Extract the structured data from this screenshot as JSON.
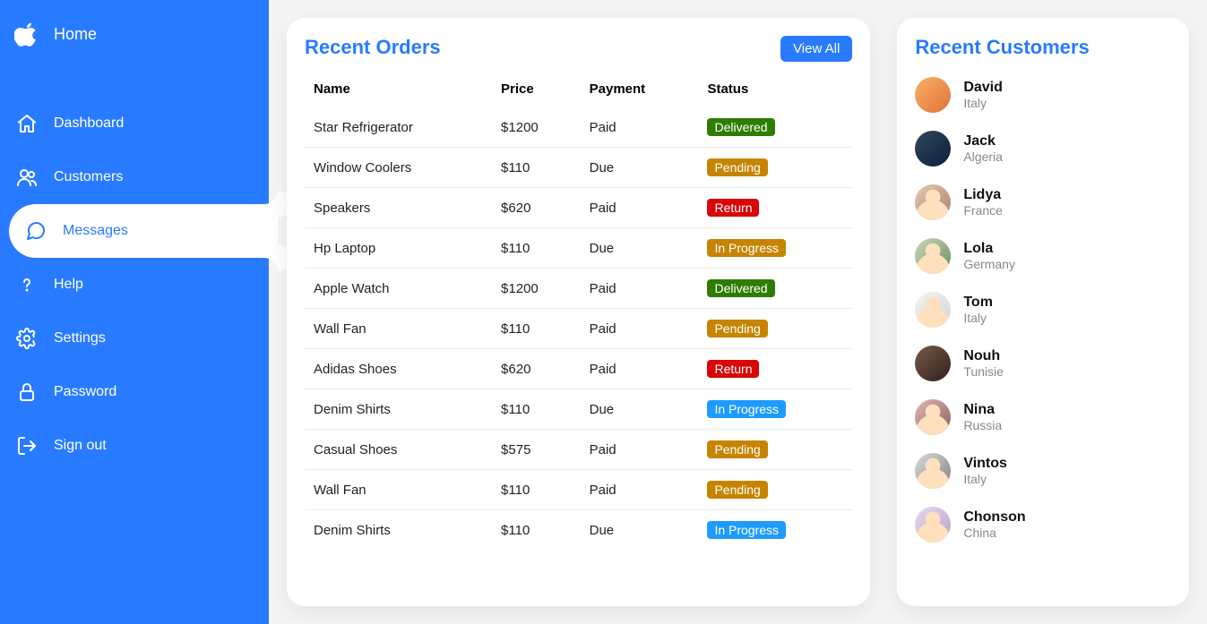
{
  "brand": {
    "label": "Home"
  },
  "nav": [
    {
      "label": "Dashboard",
      "icon": "home"
    },
    {
      "label": "Customers",
      "icon": "people"
    },
    {
      "label": "Messages",
      "icon": "chat",
      "active": true
    },
    {
      "label": "Help",
      "icon": "help"
    },
    {
      "label": "Settings",
      "icon": "gear"
    },
    {
      "label": "Password",
      "icon": "lock"
    },
    {
      "label": "Sign out",
      "icon": "signout"
    }
  ],
  "orders": {
    "title": "Recent Orders",
    "view_all": "View All",
    "columns": {
      "name": "Name",
      "price": "Price",
      "payment": "Payment",
      "status": "Status"
    },
    "rows": [
      {
        "name": "Star Refrigerator",
        "price": "$1200",
        "payment": "Paid",
        "status": "Delivered",
        "status_class": "delivered"
      },
      {
        "name": "Window Coolers",
        "price": "$110",
        "payment": "Due",
        "status": "Pending",
        "status_class": "pending"
      },
      {
        "name": "Speakers",
        "price": "$620",
        "payment": "Paid",
        "status": "Return",
        "status_class": "return"
      },
      {
        "name": "Hp Laptop",
        "price": "$110",
        "payment": "Due",
        "status": "In Progress",
        "status_class": "inprogress-1"
      },
      {
        "name": "Apple Watch",
        "price": "$1200",
        "payment": "Paid",
        "status": "Delivered",
        "status_class": "delivered"
      },
      {
        "name": "Wall Fan",
        "price": "$110",
        "payment": "Paid",
        "status": "Pending",
        "status_class": "pending"
      },
      {
        "name": "Adidas Shoes",
        "price": "$620",
        "payment": "Paid",
        "status": "Return",
        "status_class": "return"
      },
      {
        "name": "Denim Shirts",
        "price": "$110",
        "payment": "Due",
        "status": "In Progress",
        "status_class": "inprogress-2"
      },
      {
        "name": "Casual Shoes",
        "price": "$575",
        "payment": "Paid",
        "status": "Pending",
        "status_class": "pending"
      },
      {
        "name": "Wall Fan",
        "price": "$110",
        "payment": "Paid",
        "status": "Pending",
        "status_class": "pending"
      },
      {
        "name": "Denim Shirts",
        "price": "$110",
        "payment": "Due",
        "status": "In Progress",
        "status_class": "inprogress-2"
      }
    ]
  },
  "customers": {
    "title": "Recent Customers",
    "list": [
      {
        "name": "David",
        "country": "Italy",
        "avatar": "c1"
      },
      {
        "name": "Jack",
        "country": "Algeria",
        "avatar": "c2"
      },
      {
        "name": "Lidya",
        "country": "France",
        "avatar": "c3"
      },
      {
        "name": "Lola",
        "country": "Germany",
        "avatar": "c4"
      },
      {
        "name": "Tom",
        "country": "Italy",
        "avatar": "c5"
      },
      {
        "name": "Nouh",
        "country": "Tunisie",
        "avatar": "c6"
      },
      {
        "name": "Nina",
        "country": "Russia",
        "avatar": "c7"
      },
      {
        "name": "Vintos",
        "country": "Italy",
        "avatar": "c8"
      },
      {
        "name": "Chonson",
        "country": "China",
        "avatar": "c9"
      }
    ]
  }
}
